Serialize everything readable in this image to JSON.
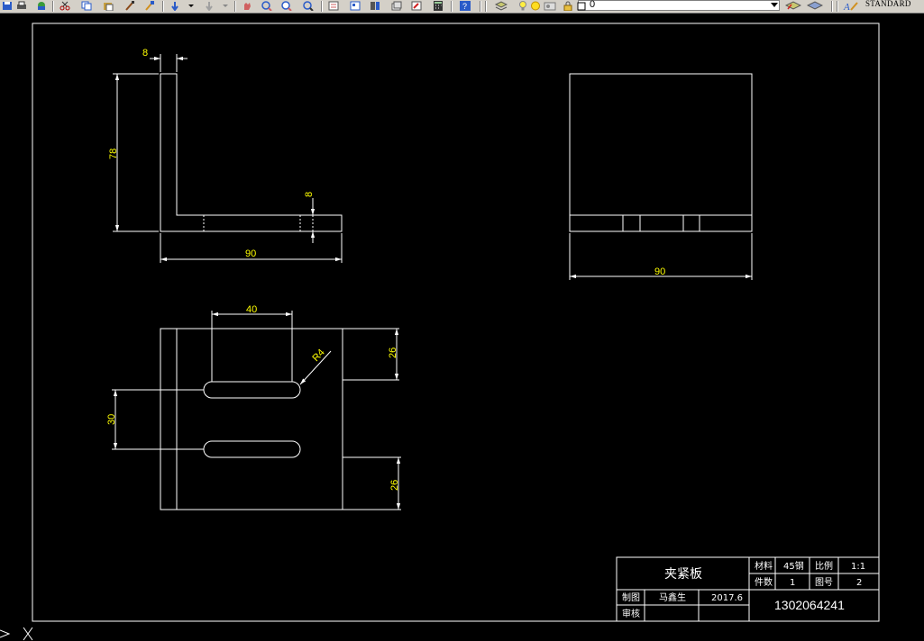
{
  "toolbar": {
    "layer_name": "0",
    "text_style": "STANDARD",
    "icons": [
      "save-icon",
      "print-icon",
      "plot-preview-icon",
      "cut-icon",
      "copy-icon",
      "paste-icon",
      "match-properties-icon",
      "paintbrush-icon",
      "undo-icon",
      "redo-icon",
      "pan-icon",
      "zoom-realtime-icon",
      "zoom-window-icon",
      "zoom-previous-icon",
      "properties-icon",
      "design-center-icon",
      "tool-palettes-icon",
      "sheet-set-icon",
      "markup-icon",
      "calculator-icon",
      "help-icon",
      "layer-properties-icon",
      "lightbulb-icon",
      "sun-icon",
      "freeze-icon",
      "lock-icon",
      "color-swatch-icon",
      "make-current-layer-icon",
      "layer-previous-icon",
      "text-style-icon"
    ]
  },
  "dimensions": {
    "front_thickness_top": "8",
    "front_height": "78",
    "front_thickness_base": "8",
    "front_width": "90",
    "side_width": "90",
    "slot_length": "40",
    "slot_radius": "R4",
    "slot_spacing": "30",
    "top_edge_offset": "26",
    "bottom_edge_offset": "26"
  },
  "title_block": {
    "part_name": "夹紧板",
    "material_label": "材料",
    "material_value": "45钢",
    "scale_label": "比例",
    "scale_value": "1:1",
    "quantity_label": "件数",
    "quantity_value": "1",
    "drawing_no_label": "图号",
    "drawing_no_value": "2",
    "drawn_by_label": "制图",
    "drawn_by_value": "马鑫生",
    "date_value": "2017.6",
    "checked_by_label": "审核",
    "phone": "1302064241"
  },
  "colors": {
    "background": "#000000",
    "geometry": "#ffffff",
    "dimension": "#ffff00",
    "toolbar": "#d4d0c8"
  }
}
